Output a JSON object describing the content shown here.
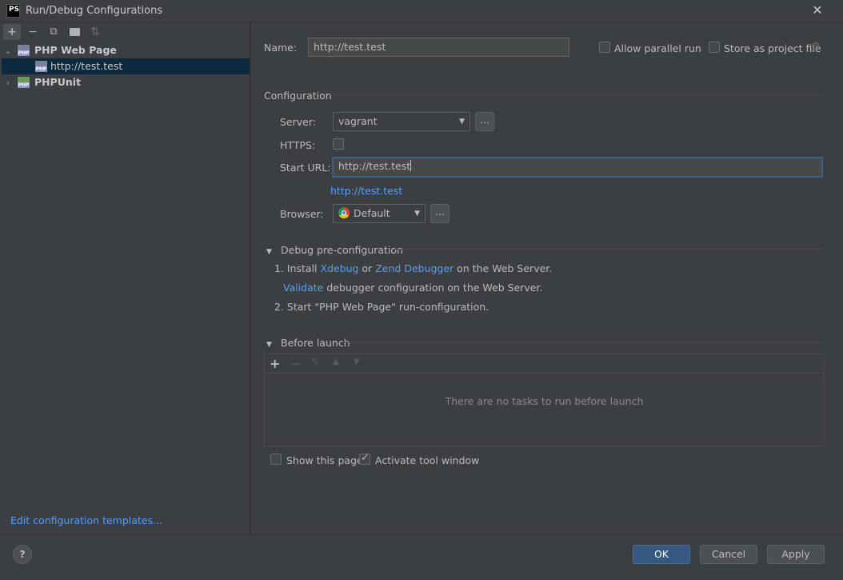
{
  "window": {
    "title": "Run/Debug Configurations",
    "app_icon_text": "PS"
  },
  "left_toolbar": {
    "add": "+",
    "remove": "−",
    "copy": "⧉",
    "folder": "▆",
    "sort": "⇅"
  },
  "tree": [
    {
      "label": "PHP Web Page",
      "expanded": true,
      "children": [
        {
          "label": "http://test.test"
        }
      ]
    },
    {
      "label": "PHPUnit",
      "expanded": false
    }
  ],
  "edit_templates_link": "Edit configuration templates...",
  "name_label": "Name:",
  "name_value": "http://test.test",
  "allow_parallel_label": "Allow parallel run",
  "store_as_project_label": "Store as project file",
  "configuration_heading": "Configuration",
  "server_label": "Server:",
  "server_value": "vagrant",
  "https_label": "HTTPS:",
  "start_url_label": "Start URL:",
  "start_url_value": "http://test.test",
  "url_preview_link": "http://test.test",
  "browser_label": "Browser:",
  "browser_value": "Default",
  "dots": "...",
  "debug_section": {
    "heading": "Debug pre-configuration",
    "step1_prefix": "1. Install ",
    "xdebug": "Xdebug",
    "or": " or ",
    "zend": "Zend Debugger",
    "step1_suffix": " on the Web Server.",
    "validate": "Validate",
    "validate_suffix": " debugger configuration on the Web Server.",
    "step2": "2. Start \"PHP Web Page\" run-configuration."
  },
  "before_launch": {
    "heading": "Before launch",
    "empty_text": "There are no tasks to run before launch"
  },
  "show_this_page_label": "Show this page",
  "activate_tool_window_label": "Activate tool window",
  "buttons": {
    "help": "?",
    "ok": "OK",
    "cancel": "Cancel",
    "apply": "Apply"
  },
  "colors": {
    "link": "#589df6",
    "primary": "#365880",
    "background": "#3c3f41"
  }
}
